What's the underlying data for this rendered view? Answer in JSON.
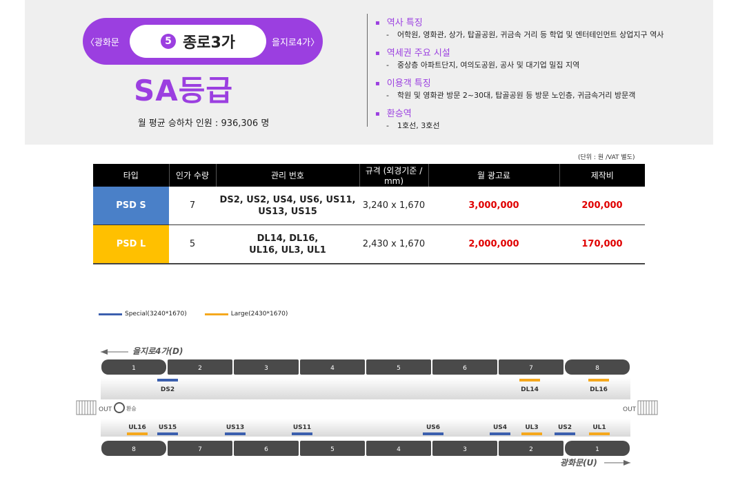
{
  "station": {
    "number": "5",
    "name": "종로3가",
    "prev": "〈광화문",
    "next": "을지로4가〉",
    "grade": "SA등급",
    "ridership_label": "월 평균 승하차 인원 :",
    "ridership_value": "936,306 명"
  },
  "info": [
    {
      "title": "역사 특징",
      "desc": "어학원, 영화관, 상가, 탑골공원, 귀금속 거리 등 학업 및 엔터테인먼트 상업지구 역사"
    },
    {
      "title": "역세권 주요 시설",
      "desc": "중상층 아파트단지, 여의도공원, 공사 및 대기업 밀집 지역"
    },
    {
      "title": "이용객 특징",
      "desc": "학원 및 영화관 방문 2~30대, 탑골공원 등 방문 노인층, 귀금속거리 방문객"
    },
    {
      "title": "환승역",
      "desc": "1호선, 3호선"
    }
  ],
  "table": {
    "unit_note": "(단위 : 원 /VAT 별도)",
    "headers": [
      "타입",
      "인가 수량",
      "관리 번호",
      "규격 (외경기준 / mm)",
      "월 광고료",
      "제작비"
    ],
    "rows": [
      {
        "type": "PSD S",
        "qty": "7",
        "codes_1": "DS2, US2, US4, US6, US11,",
        "codes_2": "US13, US15",
        "spec": "3,240 x 1,670",
        "monthly": "3,000,000",
        "production": "200,000"
      },
      {
        "type": "PSD L",
        "qty": "5",
        "codes_1": "DL14, DL16,",
        "codes_2": "UL16, UL3, UL1",
        "spec": "2,430 x 1,670",
        "monthly": "2,000,000",
        "production": "170,000"
      }
    ]
  },
  "legend": {
    "special": "Special(3240*1670)",
    "large": "Large(2430*1670)"
  },
  "colors": {
    "accent": "#9b3fe0",
    "special": "#3b5fae",
    "large": "#f5a81d",
    "price": "#e00000"
  },
  "diagram": {
    "direction_top": "을지로4가(D)",
    "direction_bottom": "광화문(U)",
    "out_left": "OUT",
    "out_right": "OUT",
    "transfer": "환승",
    "top_cars": [
      "1",
      "2",
      "3",
      "4",
      "5",
      "6",
      "7",
      "8"
    ],
    "bottom_cars": [
      "8",
      "7",
      "6",
      "5",
      "4",
      "3",
      "2",
      "1"
    ],
    "top_ads": [
      {
        "label": "DS2",
        "kind": "special"
      },
      {
        "label": "DL14",
        "kind": "large"
      },
      {
        "label": "DL16",
        "kind": "large"
      }
    ],
    "bottom_ads": [
      {
        "label": "UL16",
        "kind": "large"
      },
      {
        "label": "US15",
        "kind": "special"
      },
      {
        "label": "US13",
        "kind": "special"
      },
      {
        "label": "US11",
        "kind": "special"
      },
      {
        "label": "US6",
        "kind": "special"
      },
      {
        "label": "US4",
        "kind": "special"
      },
      {
        "label": "UL3",
        "kind": "large"
      },
      {
        "label": "US2",
        "kind": "special"
      },
      {
        "label": "UL1",
        "kind": "large"
      }
    ]
  }
}
